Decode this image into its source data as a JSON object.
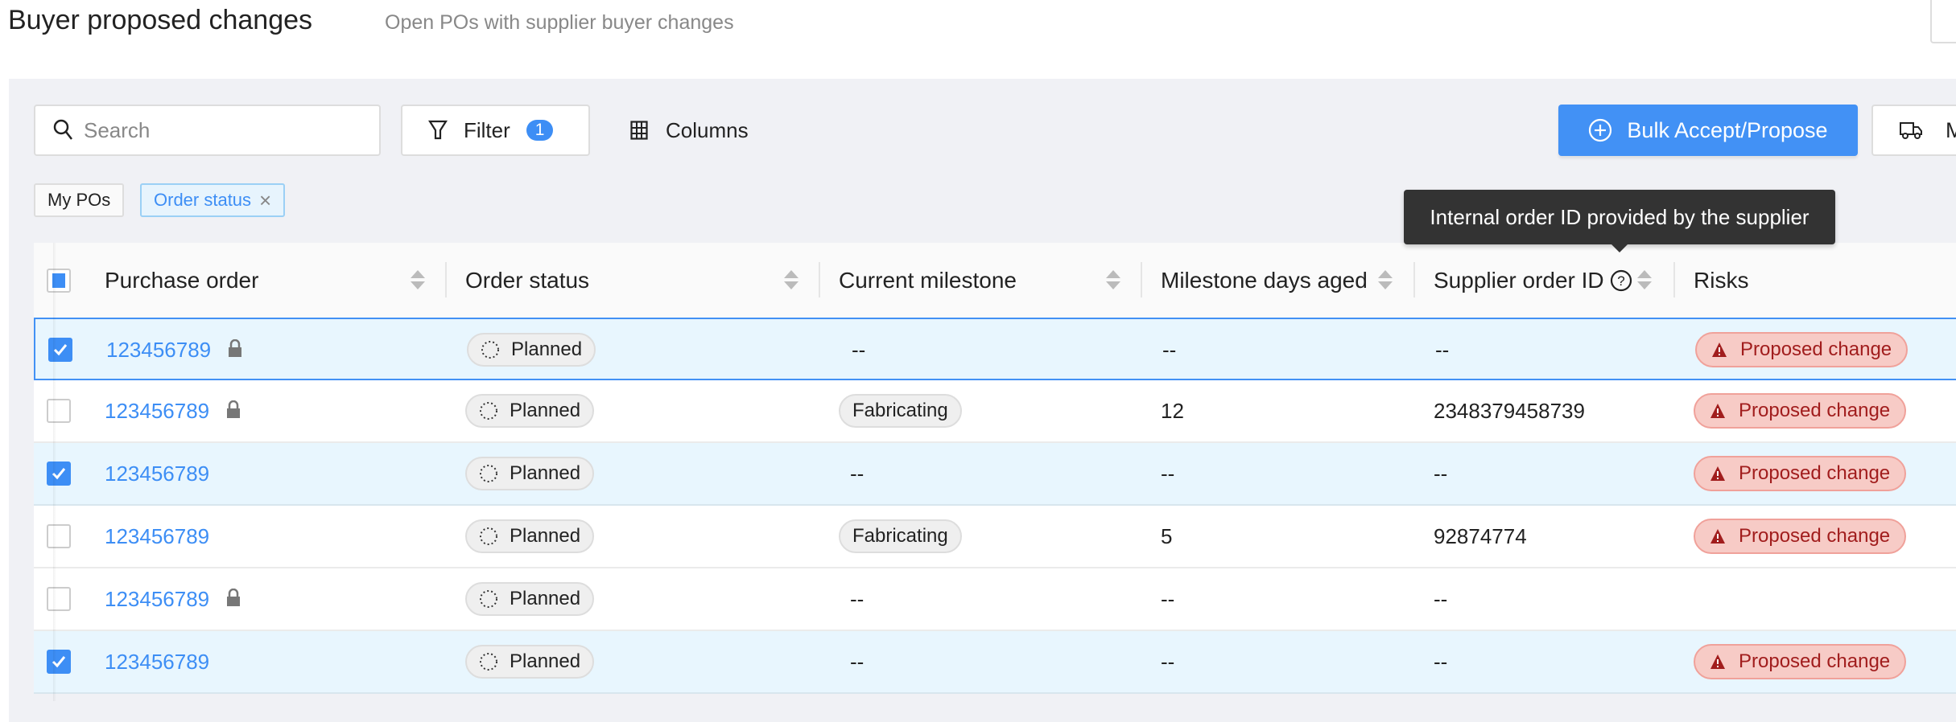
{
  "header": {
    "title": "Buyer proposed changes",
    "subtitle": "Open POs with supplier buyer changes"
  },
  "toolbar": {
    "search_placeholder": "Search",
    "filter_label": "Filter",
    "filter_count": "1",
    "columns_label": "Columns",
    "bulk_label": "Bulk Accept/Propose",
    "more_label": "M"
  },
  "chips": [
    {
      "label": "My POs"
    },
    {
      "label": "Order status",
      "remove": "×"
    }
  ],
  "tooltip": "Internal order ID provided by the supplier",
  "columns": [
    "Purchase order",
    "Order status",
    "Current milestone",
    "Milestone days aged",
    "Supplier order ID",
    "Risks"
  ],
  "rows": [
    {
      "checked": true,
      "po": "123456789",
      "locked": true,
      "status": "Planned",
      "milestone": "--",
      "days": "--",
      "supplier_id": "--",
      "risk": "Proposed change"
    },
    {
      "checked": false,
      "po": "123456789",
      "locked": true,
      "status": "Planned",
      "milestone": "Fabricating",
      "days": "12",
      "supplier_id": "2348379458739",
      "risk": "Proposed change"
    },
    {
      "checked": true,
      "po": "123456789",
      "locked": false,
      "status": "Planned",
      "milestone": "--",
      "days": "--",
      "supplier_id": "--",
      "risk": "Proposed change"
    },
    {
      "checked": false,
      "po": "123456789",
      "locked": false,
      "status": "Planned",
      "milestone": "Fabricating",
      "days": "5",
      "supplier_id": "92874774",
      "risk": "Proposed change"
    },
    {
      "checked": false,
      "po": "123456789",
      "locked": true,
      "status": "Planned",
      "milestone": "--",
      "days": "--",
      "supplier_id": "--",
      "risk": ""
    },
    {
      "checked": true,
      "po": "123456789",
      "locked": false,
      "status": "Planned",
      "milestone": "--",
      "days": "--",
      "supplier_id": "--",
      "risk": "Proposed change"
    }
  ],
  "colors": {
    "accent": "#4291f5",
    "selected_row": "#e8f6fe",
    "risk_bg": "#f7cbc6",
    "risk_text": "#a11d1d"
  }
}
